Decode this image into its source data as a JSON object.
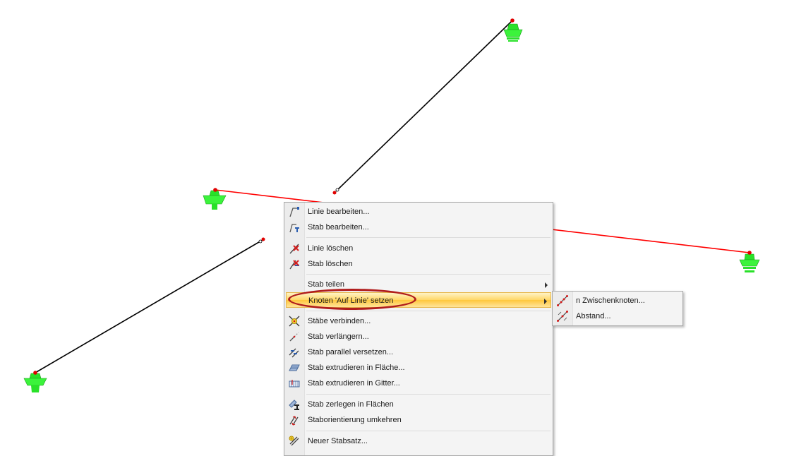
{
  "context_menu": {
    "items": [
      {
        "label": "Linie bearbeiten...",
        "icon": "edit-line-icon"
      },
      {
        "label": "Stab bearbeiten...",
        "icon": "edit-member-icon"
      },
      {
        "label": "Linie löschen",
        "icon": "delete-line-icon"
      },
      {
        "label": "Stab löschen",
        "icon": "delete-member-icon"
      },
      {
        "label": "Stab teilen",
        "icon": "divide-member-icon"
      },
      {
        "label": "Knoten 'Auf Linie' setzen",
        "icon": "node-on-line-icon"
      },
      {
        "label": "Stäbe verbinden...",
        "icon": "connect-members-icon"
      },
      {
        "label": "Stab verlängern...",
        "icon": "extend-member-icon"
      },
      {
        "label": "Stab parallel versetzen...",
        "icon": "offset-member-icon"
      },
      {
        "label": "Stab extrudieren in Fläche...",
        "icon": "extrude-surface-icon"
      },
      {
        "label": "Stab extrudieren in Gitter...",
        "icon": "extrude-grid-icon"
      },
      {
        "label": "Stab zerlegen in Flächen",
        "icon": "decompose-member-icon"
      },
      {
        "label": "Staborientierung umkehren",
        "icon": "reverse-orientation-icon"
      },
      {
        "label": "Neuer Stabsatz...",
        "icon": "new-member-set-icon"
      }
    ],
    "highlighted_index": 5
  },
  "submenu": {
    "items": [
      {
        "label": "n Zwischenknoten...",
        "icon": "intermediate-nodes-icon"
      },
      {
        "label": "Abstand...",
        "icon": "distance-icon"
      }
    ]
  },
  "colors": {
    "member": "#000000",
    "selected_member": "#ff0000",
    "node": "#e00000",
    "support": "#22dd22",
    "highlight_ring": "#b01c1c"
  }
}
